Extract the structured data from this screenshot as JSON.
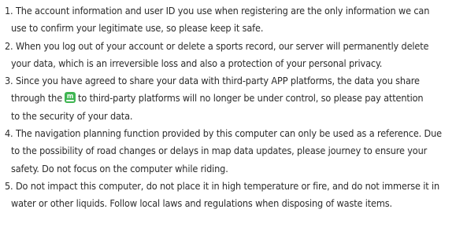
{
  "notice": {
    "items": [
      {
        "lines": [
          "1. The account information and user ID you use when registering are the only information we can",
          "use to confirm your legitimate use, so please keep it safe."
        ]
      },
      {
        "lines": [
          "2. When you log out of your account or delete a sports record, our server will permanently delete",
          "your data, which is an irreversible loss and also a protection of your personal privacy."
        ]
      },
      {
        "lines": [
          "3. Since you have agreed to share your data with third-party APP platforms, the data you share",
          "through the",
          "to third-party platforms will no longer be under control, so please pay attention",
          "to the security of your data."
        ],
        "logo": {
          "icon": "app-logo-icon",
          "letter": "m",
          "color": "#3fb552"
        }
      },
      {
        "lines": [
          "4. The navigation planning function provided by this computer can only be used as a reference. Due",
          "to the possibility of road changes or delays in map data updates, please journey to ensure your",
          "safety. Do not focus on the computer while riding."
        ]
      },
      {
        "lines": [
          "5. Do not impact this computer, do not place it in high temperature or fire, and do not immerse it in",
          "water or other liquids. Follow local laws and regulations when disposing of waste items."
        ]
      }
    ]
  }
}
